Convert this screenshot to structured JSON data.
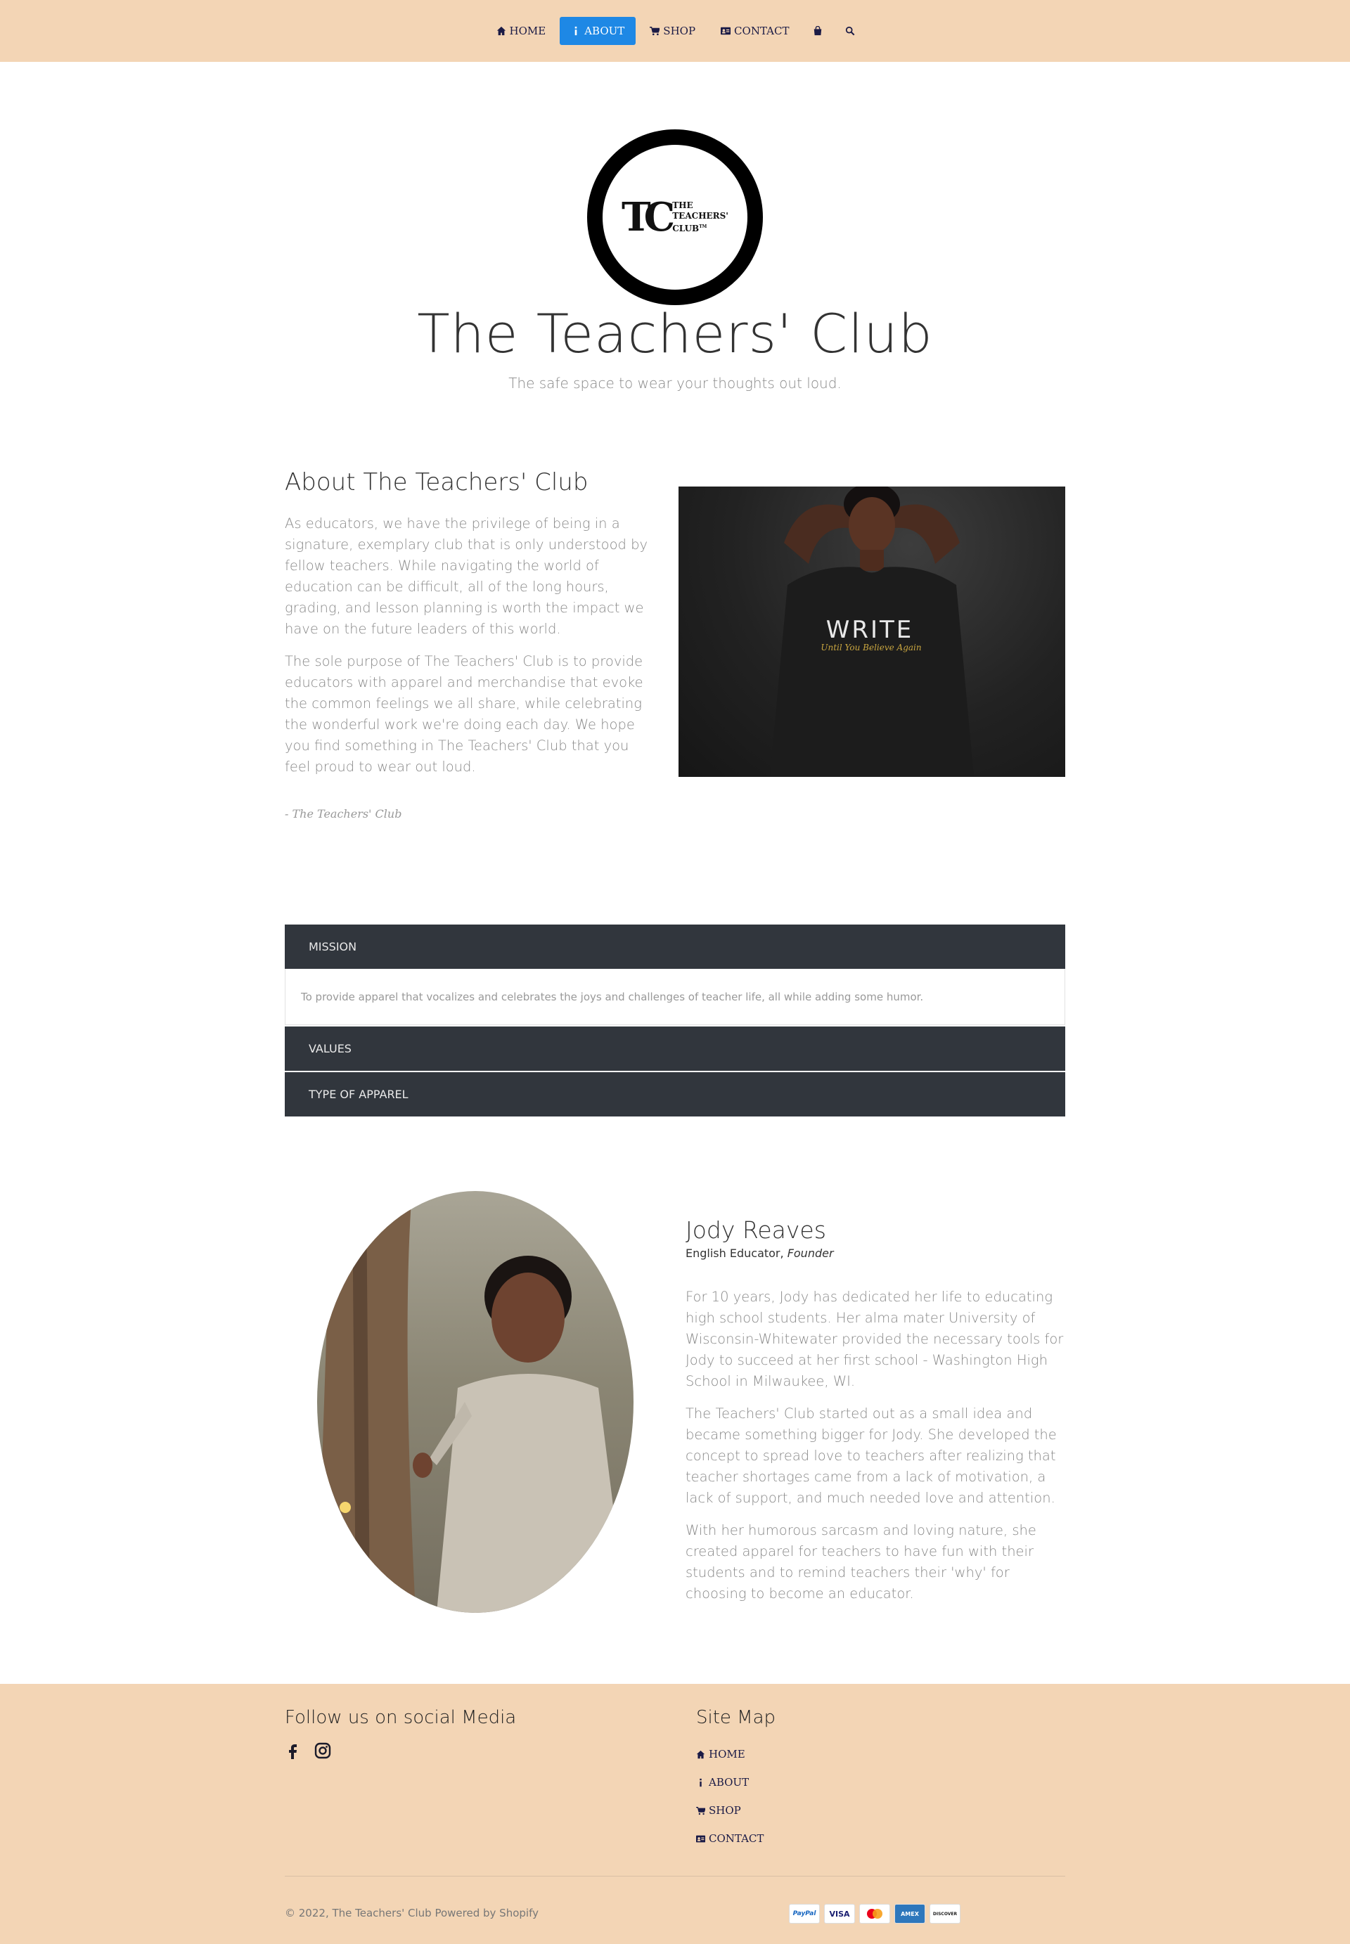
{
  "nav": {
    "items": [
      {
        "label": "HOME",
        "icon": "home-icon"
      },
      {
        "label": "ABOUT",
        "icon": "info-icon"
      },
      {
        "label": "SHOP",
        "icon": "cart-icon"
      },
      {
        "label": "CONTACT",
        "icon": "contact-card-icon"
      }
    ],
    "active": "ABOUT",
    "extra_icons": [
      "shopping-bag-icon",
      "search-icon"
    ]
  },
  "hero": {
    "logo_mark": "TC",
    "logo_text_line1": "THE",
    "logo_text_line2": "TEACHERS'",
    "logo_text_line3": "CLUB",
    "logo_tm": "TM",
    "title": "The Teachers' Club",
    "tagline": "The safe space to wear your thoughts out loud."
  },
  "about": {
    "heading": "About The Teachers' Club",
    "paragraph1": "As educators, we have the privilege of being in a signature, exemplary club that is only understood by fellow teachers. While navigating the world of education can be difficult, all of the long hours, grading, and lesson planning is worth the impact we have on the future leaders of this world.",
    "paragraph2": "The sole purpose of The Teachers' Club is to provide educators with apparel and merchandise that evoke the common feelings we all share, while celebrating the wonderful work we're doing each day. We hope you find something in The Teachers' Club that you feel proud to wear out loud.",
    "signature": "- The Teachers' Club",
    "photo_shirt_text": "WRITE",
    "photo_shirt_script": "Until You Believe Again"
  },
  "accordion": {
    "mission_title": "MISSION",
    "mission_body": "To provide apparel that vocalizes and celebrates the joys and challenges of teacher life, all while adding some humor.",
    "values_title": "VALUES",
    "apparel_title": "TYPE OF APPAREL"
  },
  "founder": {
    "name": "Jody Reaves",
    "role_prefix": "English Educator, ",
    "role_title": "Founder",
    "paragraph1": "For 10 years, Jody has dedicated her life to educating high school students. Her alma mater University of Wisconsin-Whitewater provided the necessary tools for Jody to succeed at her first school - Washington High School in Milwaukee, WI.",
    "paragraph2": "The Teachers' Club started out as a small idea and became something bigger for Jody. She developed the concept to spread love to teachers after realizing that teacher shortages came from a lack of motivation, a lack of support, and much needed love and attention.",
    "paragraph3": "With her humorous sarcasm and loving nature, she created apparel for teachers to have fun with their students and to remind teachers their 'why' for choosing to become an educator."
  },
  "footer": {
    "social_heading": "Follow us on social Media",
    "social_icons": [
      "facebook-icon",
      "instagram-icon"
    ],
    "sitemap_heading": "Site Map",
    "sitemap": [
      "HOME",
      "ABOUT",
      "SHOP",
      "CONTACT"
    ],
    "copyright": "© 2022, The Teachers' Club Powered by Shopify",
    "payments": [
      "PayPal",
      "VISA",
      "mastercard",
      "AMEX",
      "DISCOVER"
    ]
  },
  "colors": {
    "header_bg": "#f3d5b5",
    "active_nav": "#1e88e5",
    "accordion_bg": "#31363d",
    "nav_text": "#1b1b46"
  }
}
